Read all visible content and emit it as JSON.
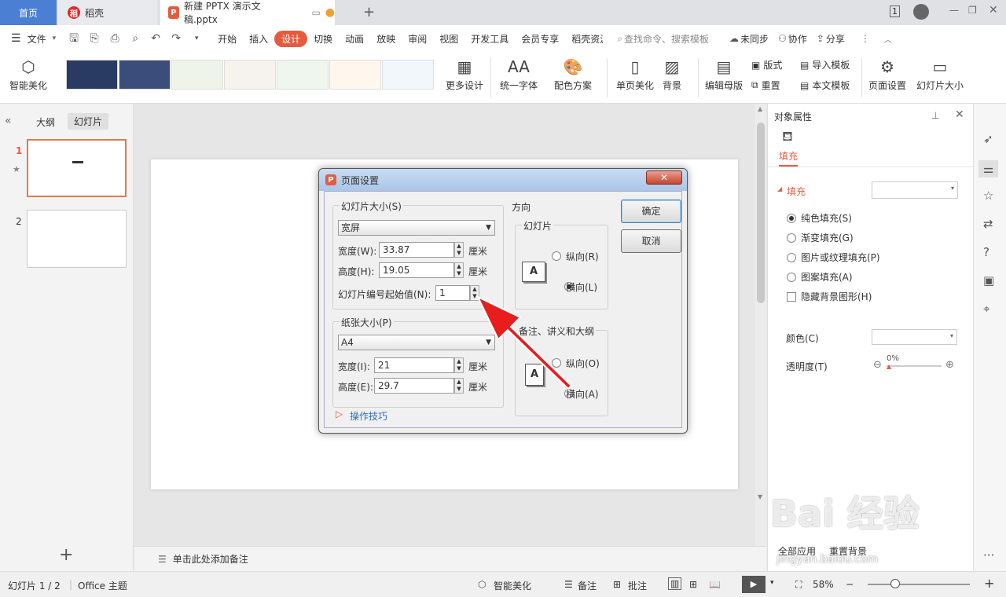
{
  "tabs": {
    "home": "首页",
    "daoke": "稻壳",
    "doc": "新建 PPTX 演示文稿.pptx"
  },
  "menu": {
    "file": "文件",
    "items": [
      "开始",
      "插入",
      "设计",
      "切换",
      "动画",
      "放映",
      "审阅",
      "视图",
      "开发工具",
      "会员专享",
      "稻壳资源"
    ],
    "active": "设计",
    "search_placeholder": "查找命令、搜索模板",
    "sync": "未同步",
    "collab": "协作",
    "share": "分享"
  },
  "ribbon": {
    "smart_beautify": "智能美化",
    "more_design": "更多设计",
    "unify_font": "统一字体",
    "color_scheme": "配色方案",
    "single_page": "单页美化",
    "background": "背景",
    "edit_master": "编辑母版",
    "layout": "版式",
    "reset": "重置",
    "import_template": "导入模板",
    "text_template": "本文模板",
    "page_setup": "页面设置",
    "slide_size": "幻灯片大小"
  },
  "left": {
    "outline": "大纲",
    "slides": "幻灯片",
    "slide1_num": "1",
    "slide2_num": "2"
  },
  "notes": "单击此处添加备注",
  "right": {
    "title": "对象属性",
    "tab_fill": "填充",
    "section_fill": "填充",
    "solid": "纯色填充(S)",
    "gradient": "渐变填充(G)",
    "picture": "图片或纹理填充(P)",
    "pattern": "图案填充(A)",
    "hide_bg": "隐藏背景图形(H)",
    "color": "颜色(C)",
    "transparency": "透明度(T)",
    "transparency_value": "0%",
    "apply_all": "全部应用",
    "reset_bg": "重置背景"
  },
  "dialog": {
    "title": "页面设置",
    "slide_size_group": "幻灯片大小(S)",
    "slide_size_value": "宽屏",
    "width_label": "宽度(W):",
    "width_value": "33.87",
    "height_label": "高度(H):",
    "height_value": "19.05",
    "unit": "厘米",
    "numbering_label": "幻灯片编号起始值(N):",
    "numbering_value": "1",
    "paper_group": "纸张大小(P)",
    "paper_value": "A4",
    "paper_width_label": "宽度(I):",
    "paper_width_value": "21",
    "paper_height_label": "高度(E):",
    "paper_height_value": "29.7",
    "tips": "操作技巧",
    "orientation": "方向",
    "slides_group": "幻灯片",
    "portrait_r": "纵向(R)",
    "landscape_l": "横向(L)",
    "notes_group": "备注、讲义和大纲",
    "portrait_o": "纵向(O)",
    "landscape_a": "横向(A)",
    "ok": "确定",
    "cancel": "取消"
  },
  "status": {
    "slide_count": "幻灯片 1 / 2",
    "theme": "Office 主题",
    "smart": "智能美化",
    "notes": "备注",
    "comment": "批注",
    "zoom": "58%"
  },
  "watermark": "Bai 经验",
  "watermark_url": "jingyan.baidu.com"
}
